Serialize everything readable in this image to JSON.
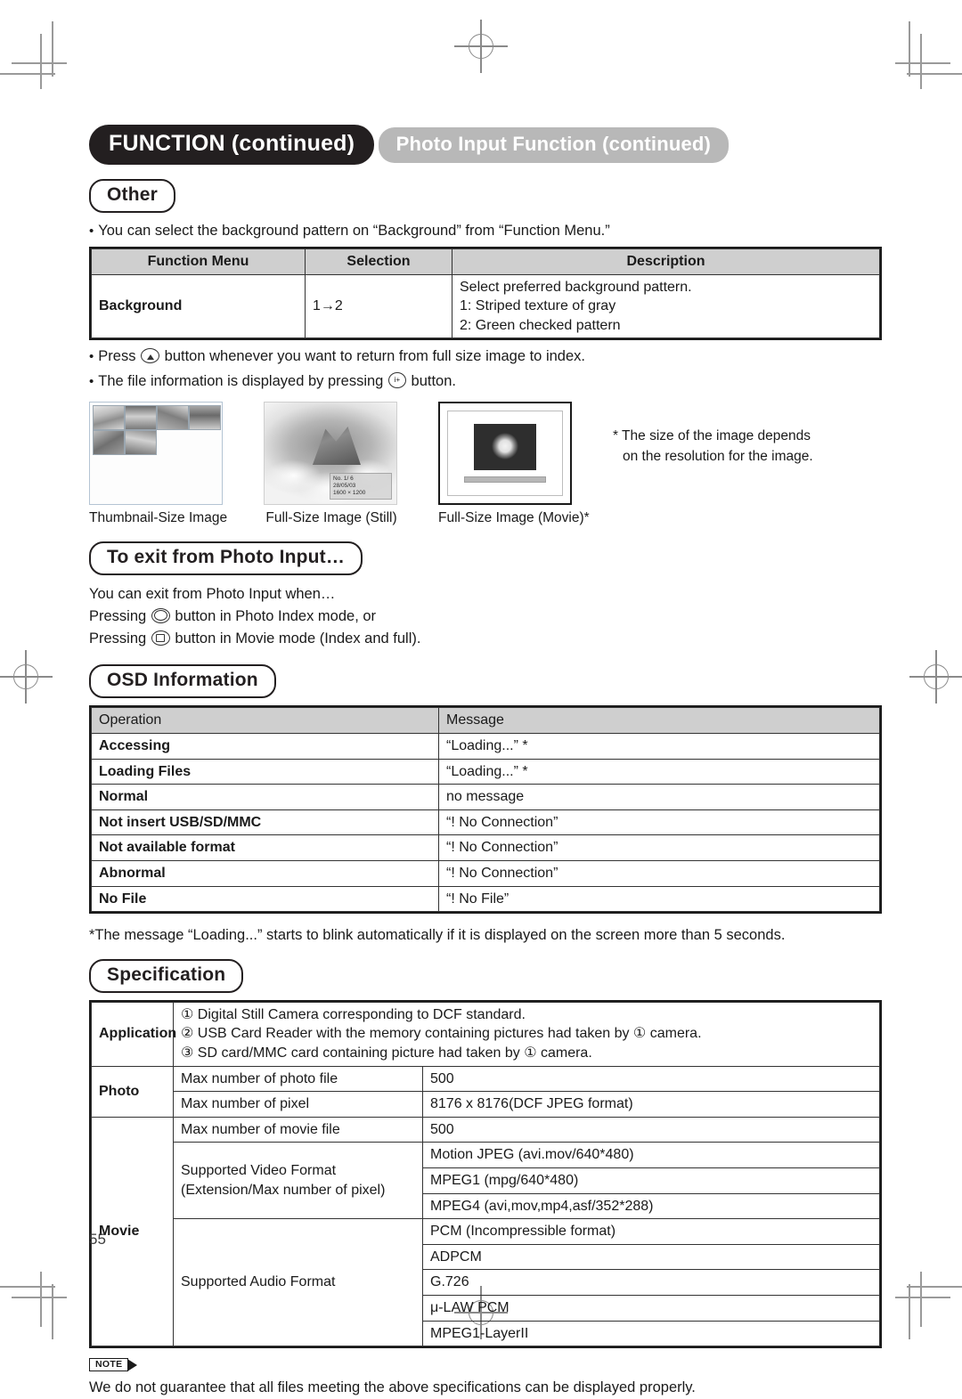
{
  "heading": {
    "chapter": "FUNCTION (continued)",
    "section": "Photo Input Function (continued)",
    "other": "Other",
    "exit": "To exit from Photo Input…",
    "osd": "OSD Information",
    "spec": "Specification"
  },
  "other": {
    "bullet_background": "You can select the background pattern on “Background” from “Function Menu.”",
    "bullet_press_a": "Press",
    "bullet_press_b": "button whenever you want to return from full size image to index.",
    "bullet_info_a": "The file information is displayed by pressing",
    "bullet_info_b": "button.",
    "table": {
      "headers": [
        "Function Menu",
        "Selection",
        "Description"
      ],
      "row": {
        "menu": "Background",
        "selection": "1→2",
        "description": [
          "Select preferred background pattern.",
          "1: Striped texture of gray",
          "2: Green checked pattern"
        ]
      }
    }
  },
  "examples": {
    "items": [
      {
        "caption": "Thumbnail-Size Image",
        "icon": "thumbnail-grid-image"
      },
      {
        "caption": "Full-Size Image (Still)",
        "icon": "full-size-still-image"
      },
      {
        "caption": "Full-Size Image (Movie)*",
        "icon": "full-size-movie-image"
      }
    ],
    "osd_overlay": {
      "line1": "No.  1/  6",
      "line2": "28/05/03",
      "line3": "1600 × 1200"
    },
    "side_note_line1": "* The size of the image depends",
    "side_note_line2": "on the resolution for the image."
  },
  "exit": {
    "line1": "You can exit from Photo Input when…",
    "line2_a": "Pressing",
    "line2_b": "button in Photo Index mode, or",
    "line3_a": "Pressing",
    "line3_b": "button in Movie mode (Index and full)."
  },
  "osd_table": {
    "headers": [
      "Operation",
      "Message"
    ],
    "rows": [
      {
        "operation": "Accessing",
        "message": "“Loading...” *"
      },
      {
        "operation": "Loading Files",
        "message": "“Loading...” *"
      },
      {
        "operation": "Normal",
        "message": "no message"
      },
      {
        "operation": "Not insert USB/SD/MMC",
        "message": "“! No Connection”"
      },
      {
        "operation": "Not available format",
        "message": "“! No Connection”"
      },
      {
        "operation": "Abnormal",
        "message": "“! No Connection”"
      },
      {
        "operation": "No File",
        "message": "“! No File”"
      }
    ],
    "footnote": "*The message “Loading...” starts to blink automatically if it is displayed on the screen more than 5 seconds."
  },
  "spec_table": {
    "application": {
      "label": "Application",
      "items": [
        "①  Digital Still Camera corresponding to DCF standard.",
        "②  USB Card Reader with the memory containing pictures had taken by ① camera.",
        "③  SD card/MMC card containing picture had taken by ① camera."
      ]
    },
    "photo": {
      "label": "Photo",
      "rows": [
        {
          "name": "Max number of photo file",
          "value": "500"
        },
        {
          "name": "Max number of pixel",
          "value": "8176 x 8176(DCF JPEG format)"
        }
      ]
    },
    "movie": {
      "label": "Movie",
      "max_file": {
        "name": "Max number of movie file",
        "value": "500"
      },
      "video_format": {
        "name_line1": "Supported Video Format",
        "name_line2": "(Extension/Max number of pixel)",
        "values": [
          "Motion JPEG (avi.mov/640*480)",
          "MPEG1 (mpg/640*480)",
          "MPEG4 (avi,mov,mp4,asf/352*288)"
        ]
      },
      "audio_format": {
        "name": "Supported Audio Format",
        "values": [
          "PCM (Incompressible format)",
          "ADPCM",
          "G.726",
          "μ-LAW PCM",
          "MPEG1-LayerII"
        ]
      }
    }
  },
  "note": {
    "tag": "NOTE",
    "text": "We do not guarantee that all files meeting the above specifications can be displayed properly."
  },
  "page_number": "55"
}
